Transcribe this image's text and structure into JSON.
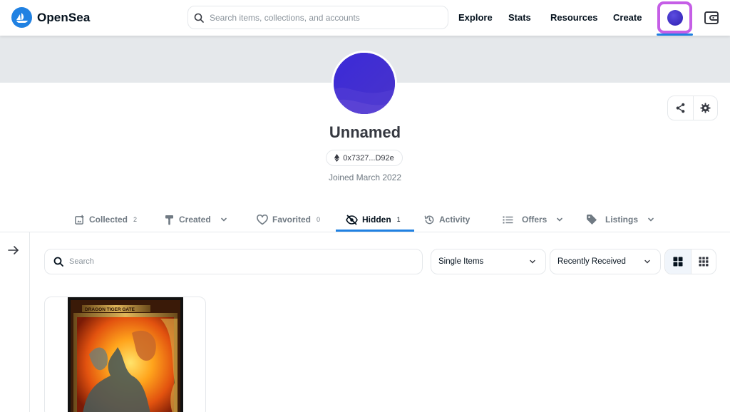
{
  "brand": {
    "name": "OpenSea",
    "color": "#2081e2"
  },
  "nav": {
    "search_placeholder": "Search items, collections, and accounts",
    "links": [
      "Explore",
      "Stats",
      "Resources",
      "Create"
    ]
  },
  "profile": {
    "name": "Unnamed",
    "address": "0x7327...D92e",
    "joined": "Joined March 2022"
  },
  "tabs": [
    {
      "label": "Collected",
      "count": "2",
      "icon": "collected-icon"
    },
    {
      "label": "Created",
      "icon": "brush-icon",
      "dropdown": true
    },
    {
      "label": "Favorited",
      "count": "0",
      "icon": "heart-icon"
    },
    {
      "label": "Hidden",
      "count": "1",
      "icon": "eye-off-icon",
      "active": true
    },
    {
      "label": "Activity",
      "icon": "history-icon"
    },
    {
      "label": "Offers",
      "icon": "list-icon",
      "dropdown": true
    },
    {
      "label": "Listings",
      "icon": "tag-icon",
      "dropdown": true
    }
  ],
  "filters": {
    "search_placeholder": "Search",
    "item_type": "Single Items",
    "sort": "Recently Received"
  },
  "card": {
    "art_label": "DRAGON TIGER GATE"
  },
  "colors": {
    "accent": "#2081e2",
    "highlight": "#c55ee6",
    "text": "#04111d",
    "muted": "#707a83",
    "border": "#e5e8eb"
  }
}
